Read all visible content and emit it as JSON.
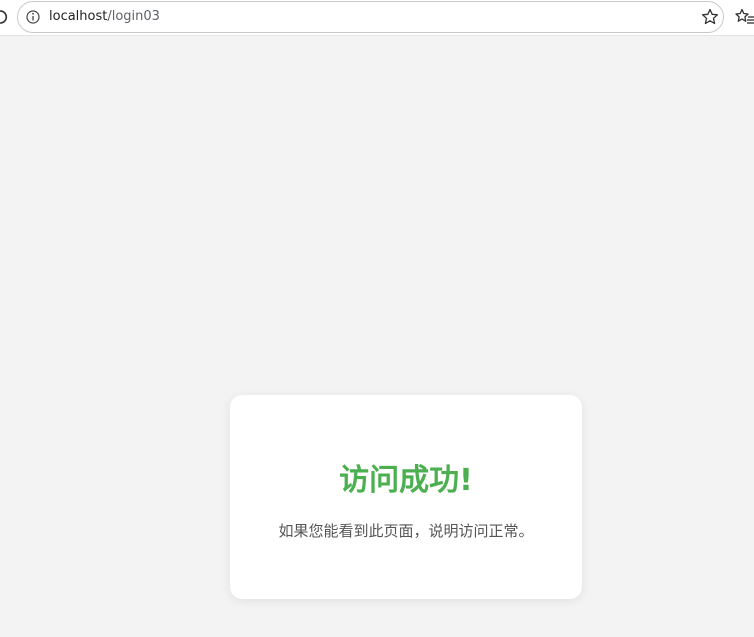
{
  "browser": {
    "url_host": "localhost",
    "url_path": "/login03"
  },
  "card": {
    "title": "访问成功!",
    "message": "如果您能看到此页面，说明访问正常。",
    "title_color": "#4caf50"
  },
  "icons": {
    "reload": "reload-icon",
    "info": "info-icon",
    "favorite": "star-icon",
    "favorites_list": "favorites-list-icon"
  }
}
